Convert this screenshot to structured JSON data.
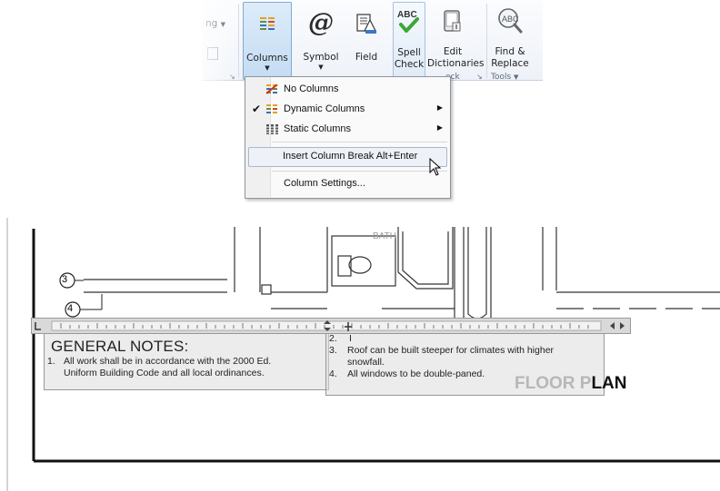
{
  "ribbon": {
    "cut_label": "ng",
    "buttons": {
      "columns": "Columns",
      "symbol": "Symbol",
      "field": "Field",
      "spell_line1": "Spell",
      "spell_line2": "Check",
      "edit_line1": "Edit",
      "edit_line2": "Dictionaries",
      "find_line1": "Find &",
      "find_line2": "Replace"
    },
    "groups": {
      "check": "eck",
      "tools": "Tools"
    }
  },
  "menu": {
    "items": [
      {
        "label": "No Columns"
      },
      {
        "label": "Dynamic Columns",
        "checked": true,
        "submenu": true
      },
      {
        "label": "Static Columns",
        "submenu": true
      },
      {
        "label": "Insert Column Break Alt+Enter",
        "highlighted": true
      },
      {
        "label": "Column Settings..."
      }
    ]
  },
  "drawing": {
    "room_label": "BATH",
    "callouts": [
      "3",
      "4"
    ],
    "notes_title": "GENERAL NOTES:",
    "notes_left": [
      {
        "num": "1.",
        "line1": "All work shall be in accordance with the 2000 Ed.",
        "line2": "Uniform Building Code and all local ordinances."
      }
    ],
    "notes_right": [
      {
        "num": "2.",
        "line1": "",
        "line2": ""
      },
      {
        "num": "3.",
        "line1": "Roof can be built steeper for climates with higher",
        "line2": "snowfall."
      },
      {
        "num": "4.",
        "line1": "All windows to be double-paned.",
        "line2": ""
      }
    ],
    "floor_plan_faded": "FLOOR P",
    "floor_plan_bold": "LAN"
  },
  "colors": {
    "ribbon_active": "#c4dcf3",
    "menu_highlight": "#e8eef6",
    "ruler_bg": "#dcdcdc",
    "drawing_line": "#222222"
  }
}
